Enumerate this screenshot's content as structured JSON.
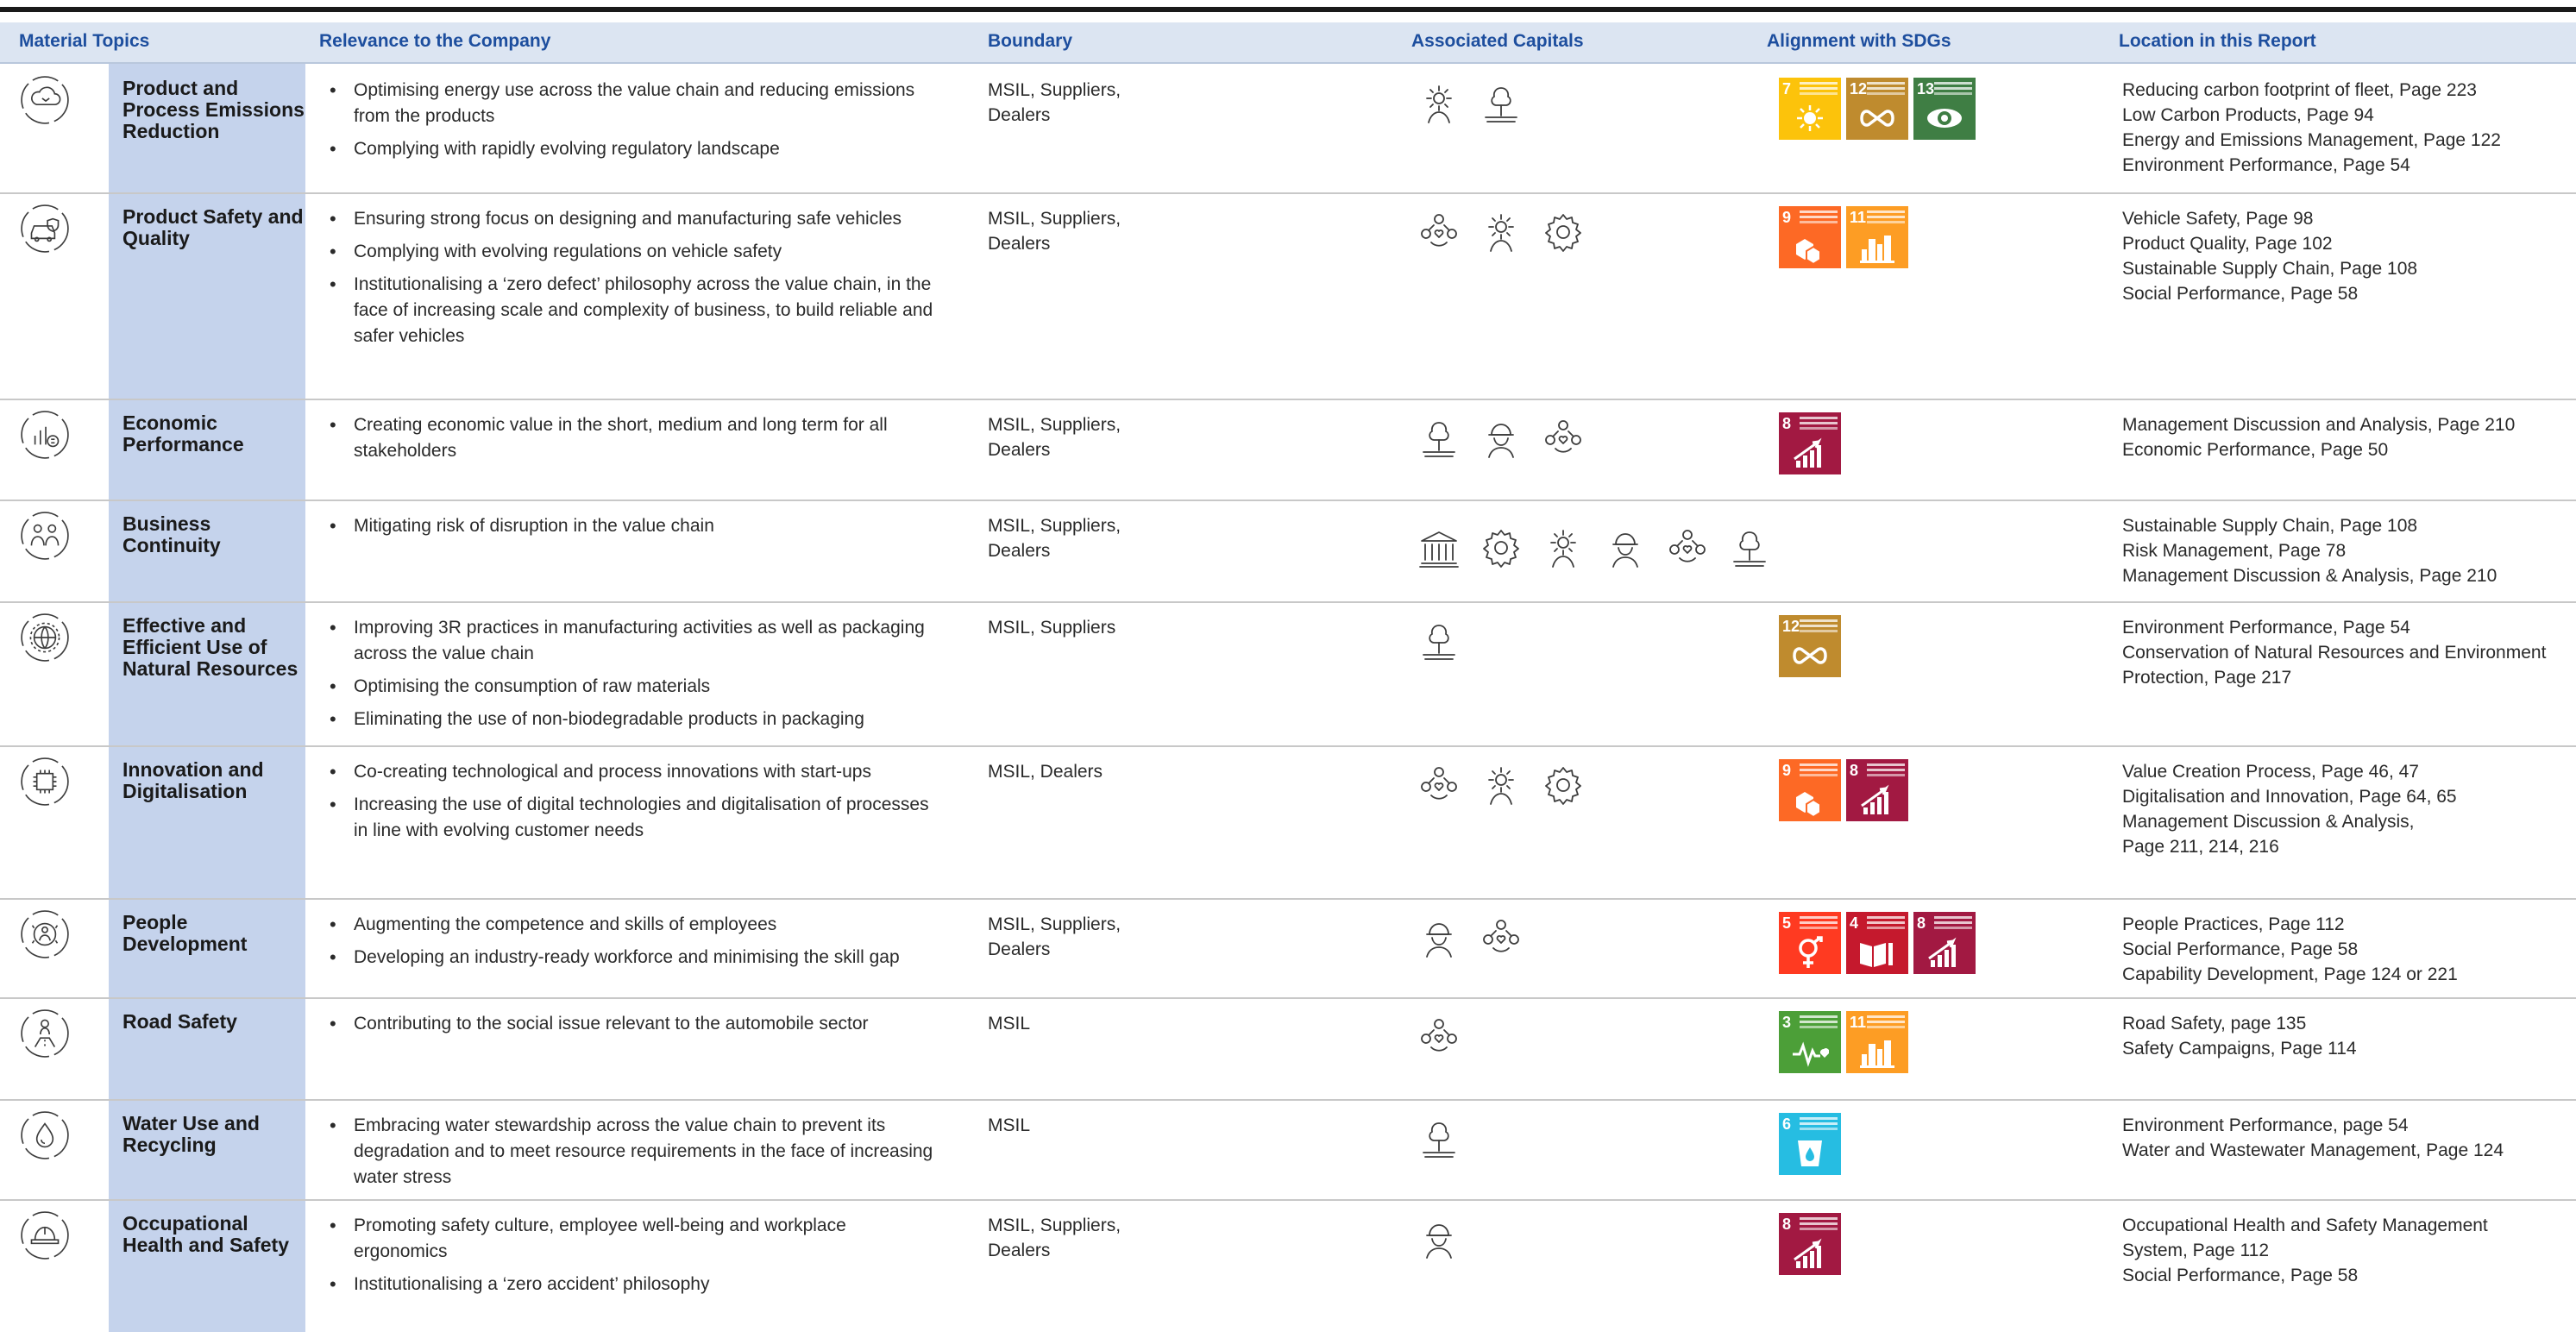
{
  "headers": {
    "topics": "Material Topics",
    "relevance": "Relevance to the Company",
    "boundary": "Boundary",
    "capitals": "Associated Capitals",
    "sdgs": "Alignment with SDGs",
    "location": "Location in this Report"
  },
  "rows": [
    {
      "topic": "Product and Process Emissions Reduction",
      "icon": "cloud-recycle-icon",
      "relevance": [
        "Optimising energy use across the value chain and reducing emissions from the products",
        "Complying with rapidly evolving regulatory landscape"
      ],
      "boundary": "MSIL, Suppliers, Dealers",
      "capitals": [
        "sun-person-icon",
        "tree-water-icon"
      ],
      "sdgs": [
        {
          "num": "7",
          "color": "#fcc30b"
        },
        {
          "num": "12",
          "color": "#bf8b2e"
        },
        {
          "num": "13",
          "color": "#3f7e44"
        }
      ],
      "location": [
        "Reducing carbon footprint of fleet, Page 223",
        "Low Carbon Products, Page 94",
        "Energy and Emissions Management, Page 122",
        "Environment Performance, Page 54"
      ]
    },
    {
      "topic": "Product Safety and Quality",
      "icon": "car-shield-icon",
      "relevance": [
        "Ensuring strong focus on designing and manufacturing safe vehicles",
        "Complying with evolving regulations on vehicle safety",
        "Institutionalising a ‘zero defect’ philosophy across the value chain, in the face of increasing scale and complexity of business, to build reliable and safer vehicles"
      ],
      "boundary": "MSIL, Suppliers, Dealers",
      "capitals": [
        "people-heart-icon",
        "sun-person-icon",
        "gear-icon"
      ],
      "sdgs": [
        {
          "num": "9",
          "color": "#fd6925"
        },
        {
          "num": "11",
          "color": "#fd9d24"
        }
      ],
      "location": [
        "Vehicle Safety, Page 98",
        "Product Quality, Page 102",
        "Sustainable Supply Chain, Page 108",
        "Social Performance, Page 58"
      ]
    },
    {
      "topic": "Economic Performance",
      "icon": "chart-coin-icon",
      "relevance": [
        "Creating economic value in the short, medium and long term for all stakeholders"
      ],
      "boundary": "MSIL, Suppliers, Dealers",
      "capitals": [
        "tree-water-icon",
        "worker-helmet-icon",
        "people-heart-icon"
      ],
      "sdgs": [
        {
          "num": "8",
          "color": "#a21942"
        }
      ],
      "location": [
        "Management Discussion and Analysis, Page 210",
        "Economic Performance, Page 50"
      ]
    },
    {
      "topic": "Business Continuity",
      "icon": "people-link-icon",
      "relevance": [
        "Mitigating risk of disruption in the value chain"
      ],
      "boundary": "MSIL, Suppliers, Dealers",
      "capitals": [
        "bank-icon",
        "gear-icon",
        "sun-person-icon",
        "worker-helmet-icon",
        "people-heart-icon",
        "tree-water-icon"
      ],
      "sdgs": [],
      "location": [
        "Sustainable Supply Chain, Page 108",
        "Risk Management, Page 78",
        "Management Discussion & Analysis, Page 210"
      ]
    },
    {
      "topic": "Effective and Efficient Use of Natural Resources",
      "icon": "globe-gear-icon",
      "relevance": [
        "Improving 3R practices in manufacturing activities as well as packaging across the value chain",
        "Optimising the consumption of raw materials",
        "Eliminating the use of non-biodegradable products in packaging"
      ],
      "boundary": "MSIL, Suppliers",
      "capitals": [
        "tree-water-icon"
      ],
      "sdgs": [
        {
          "num": "12",
          "color": "#bf8b2e"
        }
      ],
      "location": [
        "Environment Performance, Page 54",
        "Conservation of Natural Resources and Environment",
        "Protection, Page 217"
      ]
    },
    {
      "topic": "Innovation and Digitalisation",
      "icon": "circuit-icon",
      "relevance": [
        "Co-creating technological and process innovations with start-ups",
        "Increasing the use of digital technologies and digitalisation of processes in line with evolving customer needs"
      ],
      "boundary": "MSIL, Dealers",
      "capitals": [
        "people-heart-icon",
        "sun-person-icon",
        "gear-icon"
      ],
      "sdgs": [
        {
          "num": "9",
          "color": "#fd6925"
        },
        {
          "num": "8",
          "color": "#a21942"
        }
      ],
      "location": [
        "Value Creation Process, Page 46, 47",
        "Digitalisation and Innovation, Page 64, 65",
        "Management Discussion & Analysis,",
        "Page 211, 214, 216"
      ]
    },
    {
      "topic": "People Development",
      "icon": "people-circle-icon",
      "relevance": [
        "Augmenting the competence and skills of employees",
        "Developing an industry-ready workforce and minimising the skill gap"
      ],
      "boundary": "MSIL, Suppliers, Dealers",
      "capitals": [
        "worker-helmet-icon",
        "people-heart-icon"
      ],
      "sdgs": [
        {
          "num": "5",
          "color": "#ff3a21"
        },
        {
          "num": "4",
          "color": "#c5192d"
        },
        {
          "num": "8",
          "color": "#a21942"
        }
      ],
      "location": [
        "People Practices, Page 112",
        "Social Performance, Page 58",
        "Capability Development, Page 124 or 221"
      ]
    },
    {
      "topic": "Road Safety",
      "icon": "road-person-icon",
      "relevance": [
        "Contributing to the social issue relevant to the automobile sector"
      ],
      "boundary": "MSIL",
      "capitals": [
        "people-heart-icon"
      ],
      "sdgs": [
        {
          "num": "3",
          "color": "#4c9f38"
        },
        {
          "num": "11",
          "color": "#fd9d24"
        }
      ],
      "location": [
        "Road Safety, page 135",
        "Safety Campaigns, Page 114"
      ]
    },
    {
      "topic": "Water Use and Recycling",
      "icon": "water-drop-icon",
      "relevance": [
        "Embracing water stewardship across the value chain to prevent its degradation and to meet resource requirements in the face of increasing water stress"
      ],
      "boundary": "MSIL",
      "capitals": [
        "tree-water-icon"
      ],
      "sdgs": [
        {
          "num": "6",
          "color": "#26bde2"
        }
      ],
      "location": [
        "Environment Performance, page 54",
        "Water and Wastewater Management, Page 124"
      ]
    },
    {
      "topic": "Occupational Health and Safety",
      "icon": "hard-hat-icon",
      "relevance": [
        "Promoting safety culture, employee well-being and workplace ergonomics",
        "Institutionalising a ‘zero accident’ philosophy"
      ],
      "boundary": "MSIL, Suppliers, Dealers",
      "capitals": [
        "worker-helmet-icon"
      ],
      "sdgs": [
        {
          "num": "8",
          "color": "#a21942"
        }
      ],
      "location": [
        "Occupational Health and Safety Management",
        "System, Page 112",
        "Social Performance, Page 58"
      ]
    }
  ]
}
